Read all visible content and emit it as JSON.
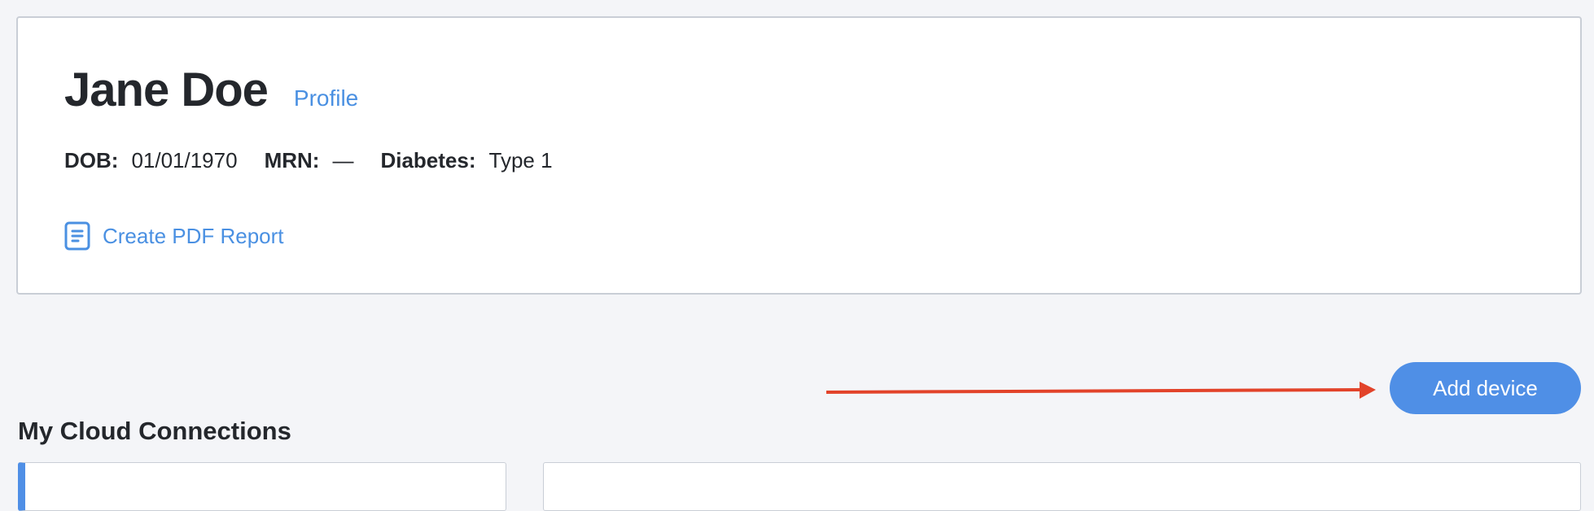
{
  "patient": {
    "name": "Jane Doe",
    "profile_link": "Profile",
    "dob_label": "DOB:",
    "dob_value": "01/01/1970",
    "mrn_label": "MRN:",
    "mrn_value": "—",
    "diabetes_label": "Diabetes:",
    "diabetes_value": "Type 1",
    "pdf_report_label": "Create PDF Report"
  },
  "actions": {
    "add_device_label": "Add device"
  },
  "cloud_connections": {
    "title": "My Cloud Connections"
  },
  "colors": {
    "accent": "#4f8fe6",
    "link": "#4a90e2",
    "annotation_arrow": "#e2432a",
    "page_background": "#f4f5f8"
  },
  "icons": {
    "pdf_report": "document-icon"
  }
}
